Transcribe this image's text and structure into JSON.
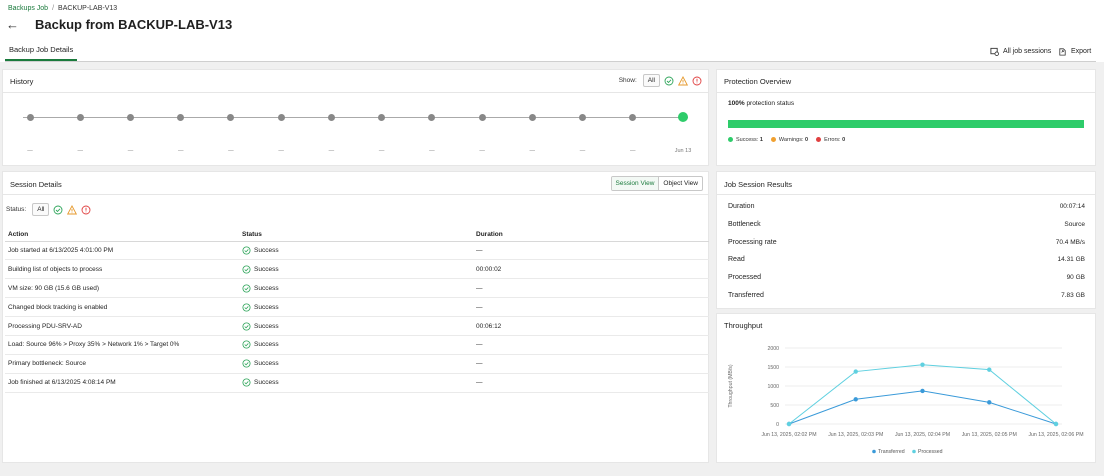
{
  "breadcrumb": {
    "parent": "Backups Job",
    "separator": "/",
    "current": "BACKUP-LAB-V13"
  },
  "page": {
    "title": "Backup from BACKUP-LAB-V13",
    "tab": "Backup Job Details"
  },
  "toolbar": {
    "all_sessions": "All job sessions",
    "export": "Export"
  },
  "history": {
    "title": "History",
    "show_label": "Show:",
    "filter_all": "All",
    "points": [
      {
        "label": "—"
      },
      {
        "label": "—"
      },
      {
        "label": "—"
      },
      {
        "label": "—"
      },
      {
        "label": "—"
      },
      {
        "label": "—"
      },
      {
        "label": "—"
      },
      {
        "label": "—"
      },
      {
        "label": "—"
      },
      {
        "label": "—"
      },
      {
        "label": "—"
      },
      {
        "label": "—"
      },
      {
        "label": "—"
      },
      {
        "label": "Jun 13"
      }
    ]
  },
  "protection": {
    "title": "Protection Overview",
    "percent_text": "100%",
    "status_text": "protection status",
    "fill_percent": 100,
    "legend": [
      {
        "label": "Success:",
        "value": "1",
        "color": "#2ecc6a"
      },
      {
        "label": "Warnings:",
        "value": "0",
        "color": "#f0a030"
      },
      {
        "label": "Errors:",
        "value": "0",
        "color": "#e04040"
      }
    ]
  },
  "session": {
    "title": "Session Details",
    "view_session": "Session View",
    "view_object": "Object View",
    "status_label": "Status:",
    "filter_all": "All",
    "columns": [
      "Action",
      "Status",
      "Duration"
    ],
    "rows": [
      {
        "action": "Job started at 6/13/2025 4:01:00 PM",
        "status": "Success",
        "duration": "—"
      },
      {
        "action": "Building list of objects to process",
        "status": "Success",
        "duration": "00:00:02"
      },
      {
        "action": "VM size: 90 GB (15.6 GB used)",
        "status": "Success",
        "duration": "—"
      },
      {
        "action": "Changed block tracking is enabled",
        "status": "Success",
        "duration": "—"
      },
      {
        "action": "Processing PDU-SRV-AD",
        "status": "Success",
        "duration": "00:06:12"
      },
      {
        "action": "Load: Source 96% > Proxy 35% > Network 1% > Target 0%",
        "status": "Success",
        "duration": "—"
      },
      {
        "action": "Primary bottleneck: Source",
        "status": "Success",
        "duration": "—"
      },
      {
        "action": "Job finished at 6/13/2025 4:08:14 PM",
        "status": "Success",
        "duration": "—"
      }
    ]
  },
  "results": {
    "title": "Job Session Results",
    "rows": [
      {
        "label": "Duration",
        "value": "00:07:14"
      },
      {
        "label": "Bottleneck",
        "value": "Source"
      },
      {
        "label": "Processing rate",
        "value": "70.4 MB/s"
      },
      {
        "label": "Read",
        "value": "14.31 GB"
      },
      {
        "label": "Processed",
        "value": "90 GB"
      },
      {
        "label": "Transferred",
        "value": "7.83 GB"
      }
    ]
  },
  "throughput": {
    "title": "Throughput",
    "colors": {
      "transferred": "#3a9ad9",
      "processed": "#5fd0e0"
    }
  },
  "chart_data": {
    "type": "line",
    "ylabel": "Throughput (MB/s)",
    "ylim": [
      0,
      2000
    ],
    "yticks": [
      "2000",
      "1500",
      "1000",
      "500",
      "0"
    ],
    "x": [
      "Jun 13, 2025, 02:02 PM",
      "Jun 13, 2025, 02:03 PM",
      "Jun 13, 2025, 02:04 PM",
      "Jun 13, 2025, 02:05 PM",
      "Jun 13, 2025, 02:06 PM"
    ],
    "point_x": [
      0,
      1,
      2,
      3,
      4,
      5
    ],
    "categories_at": [
      0,
      1,
      2,
      3,
      4
    ],
    "series": [
      {
        "name": "Transferred",
        "values": [
          0,
          650,
          870,
          570,
          0
        ]
      },
      {
        "name": "Processed",
        "values": [
          0,
          1380,
          1560,
          1430,
          0
        ]
      }
    ],
    "grid": true,
    "legend": "bottom-center"
  }
}
